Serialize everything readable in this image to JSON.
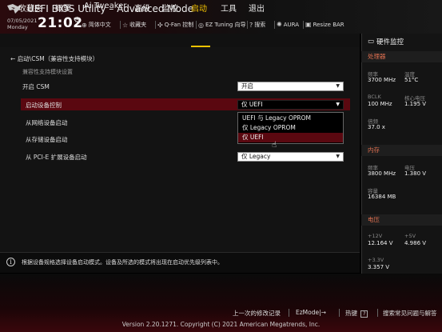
{
  "header": {
    "title": "UEFI BIOS Utility – Advanced Mode",
    "date": "07/05/2021",
    "day": "Monday",
    "time": "21:02",
    "items": [
      {
        "icon": "globe-icon",
        "label": "简体中文"
      },
      {
        "icon": "star-icon",
        "label": "收藏夹"
      },
      {
        "icon": "fan-icon",
        "label": "Q-Fan 控制"
      },
      {
        "icon": "tuning-icon",
        "label": "EZ Tuning 向导"
      },
      {
        "icon": "question-icon",
        "label": "搜索"
      },
      {
        "icon": "aura-icon",
        "label": "AURA"
      },
      {
        "icon": "resize-bar-icon",
        "label": "Resize BAR"
      }
    ]
  },
  "nav": {
    "tabs": [
      "收藏夹",
      "概要",
      "Ai Tweaker",
      "高级",
      "监控",
      "启动",
      "工具",
      "退出"
    ],
    "active": "启动"
  },
  "main": {
    "breadcrumb": "启动\\CSM（兼容性支持模块）",
    "section_desc": "兼容性支持模块设置",
    "rows": [
      {
        "label": "开启 CSM",
        "value": "开启"
      },
      {
        "label": "启动设备控制",
        "value": "仅 UEFI"
      },
      {
        "label": "从网络设备启动",
        "value": ""
      },
      {
        "label": "从存储设备启动",
        "value": ""
      },
      {
        "label": "从 PCI-E 扩展设备启动",
        "value": "仅 Legacy"
      }
    ],
    "dropdown_options": [
      "UEFI 与 Legacy OPROM",
      "仅 Legacy OPROM",
      "仅 UEFI"
    ],
    "dropdown_selected": "仅 UEFI"
  },
  "info": {
    "text": "根据设备规格选择设备启动模式。设备及所选的模式将出现在启动优先级列表中。"
  },
  "sidebar": {
    "title": "硬件监控",
    "cpu": {
      "title": "处理器",
      "freq_label": "频率",
      "freq": "3700 MHz",
      "temp_label": "温度",
      "temp": "51°C",
      "bclk_label": "BCLK",
      "bclk": "100 MHz",
      "vcore_label": "核心电压",
      "vcore": "1.195 V",
      "ratio_label": "倍频",
      "ratio": "37.0 x"
    },
    "memory": {
      "title": "内存",
      "freq_label": "频率",
      "freq": "3800 MHz",
      "volt_label": "电压",
      "volt": "1.380 V",
      "cap_label": "容量",
      "cap": "16384 MB"
    },
    "voltage": {
      "title": "电压",
      "v12_label": "+12V",
      "v12": "12.164 V",
      "v5_label": "+5V",
      "v5": "4.986 V",
      "v33_label": "+3.3V",
      "v33": "3.357 V"
    }
  },
  "footer": {
    "last_modified": "上一次的修改记录",
    "ezmode": "EzMode|→",
    "hotkeys": "热键",
    "hotkey_key": "?",
    "search_faq": "搜索常见问题与解答",
    "version": "Version 2.20.1271. Copyright (C) 2021 American Megatrends, Inc."
  },
  "colors": {
    "accent": "#f3c200",
    "highlight": "#5a0810",
    "sidebar_section": "#e07050"
  }
}
